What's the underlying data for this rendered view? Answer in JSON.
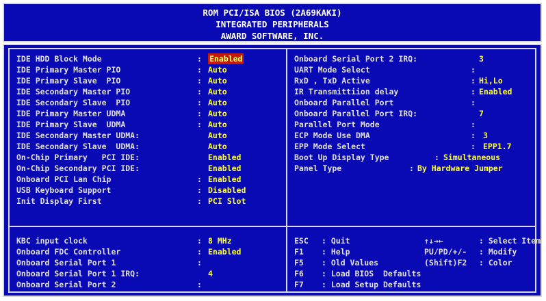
{
  "header": {
    "line1": "ROM PCI/ISA BIOS (2A69KAKI)",
    "line2": "INTEGRATED PERIPHERALS",
    "line3": "AWARD SOFTWARE, INC."
  },
  "left_settings": [
    {
      "label": "IDE HDD Block Mode",
      "value": "Enabled",
      "selected": true
    },
    {
      "label": "IDE Primary Master PIO",
      "value": "Auto"
    },
    {
      "label": "IDE Primary Slave  PIO",
      "value": "Auto"
    },
    {
      "label": "IDE Secondary Master PIO",
      "value": "Auto"
    },
    {
      "label": "IDE Secondary Slave  PIO",
      "value": "Auto"
    },
    {
      "label": "IDE Primary Master UDMA",
      "value": "Auto"
    },
    {
      "label": "IDE Primary Slave  UDMA",
      "value": "Auto"
    },
    {
      "label": "IDE Secondary Master UDMA:",
      "value": "Auto"
    },
    {
      "label": "IDE Secondary Slave  UDMA:",
      "value": "Auto"
    },
    {
      "label": "On-Chip Primary   PCI IDE:",
      "value": "Enabled"
    },
    {
      "label": "On-Chip Secondary PCI IDE:",
      "value": "Enabled"
    },
    {
      "label": "Onboard PCI Lan Chip",
      "value": "Enabled"
    },
    {
      "label": "USB Keyboard Support",
      "value": "Disabled"
    },
    {
      "label": "Init Display First",
      "value": "PCI Slot"
    }
  ],
  "left_bottom_settings": [
    {
      "label": "KBC input clock",
      "value": "8 MHz"
    },
    {
      "label": "Onboard FDC Controller",
      "value": "Enabled"
    },
    {
      "label": "Onboard Serial Port 1",
      "value": ""
    },
    {
      "label": "Onboard Serial Port 1 IRQ:",
      "value": "4"
    },
    {
      "label": "Onboard Serial Port 2",
      "value": ""
    }
  ],
  "right_settings": [
    {
      "label": "Onboard Serial Port 2 IRQ:",
      "value": "3"
    },
    {
      "label": "UART Mode Select",
      "value": ""
    },
    {
      "label": "RxD , TxD Active",
      "value": "Hi,Lo"
    },
    {
      "label": "IR Transmittiion delay",
      "value": "Enabled"
    },
    {
      "label": "Onboard Parallel Port",
      "value": ""
    },
    {
      "label": "Onboard Parallel Port IRQ:",
      "value": "7"
    },
    {
      "label": "Parallel Port Mode",
      "value": ""
    },
    {
      "label": "ECP Mode Use DMA",
      "value": "3"
    },
    {
      "label": "EPP Mode Select",
      "value": "EPP1.7"
    },
    {
      "label": "Boot Up Display Type",
      "value": "Simultaneous"
    },
    {
      "label": "Panel Type",
      "value": "By Hardware Jumper"
    }
  ],
  "help_keys": [
    {
      "key": "ESC",
      "desc": ": Quit",
      "key2": "↑↓→←",
      "desc2": ": Select Item"
    },
    {
      "key": "F1",
      "desc": ": Help",
      "key2": "PU/PD/+/-",
      "desc2": ": Modify"
    },
    {
      "key": "F5",
      "desc": ": Old Values",
      "key2": "(Shift)F2",
      "desc2": ": Color"
    },
    {
      "key": "F6",
      "desc": ": Load BIOS  Defaults",
      "key2": "",
      "desc2": ""
    },
    {
      "key": "F7",
      "desc": ": Load Setup Defaults",
      "key2": "",
      "desc2": ""
    }
  ],
  "colors": {
    "background": "#0a0ab4",
    "label": "#e0e0e0",
    "value": "#ffff3a",
    "selection": "#c41a0c"
  }
}
